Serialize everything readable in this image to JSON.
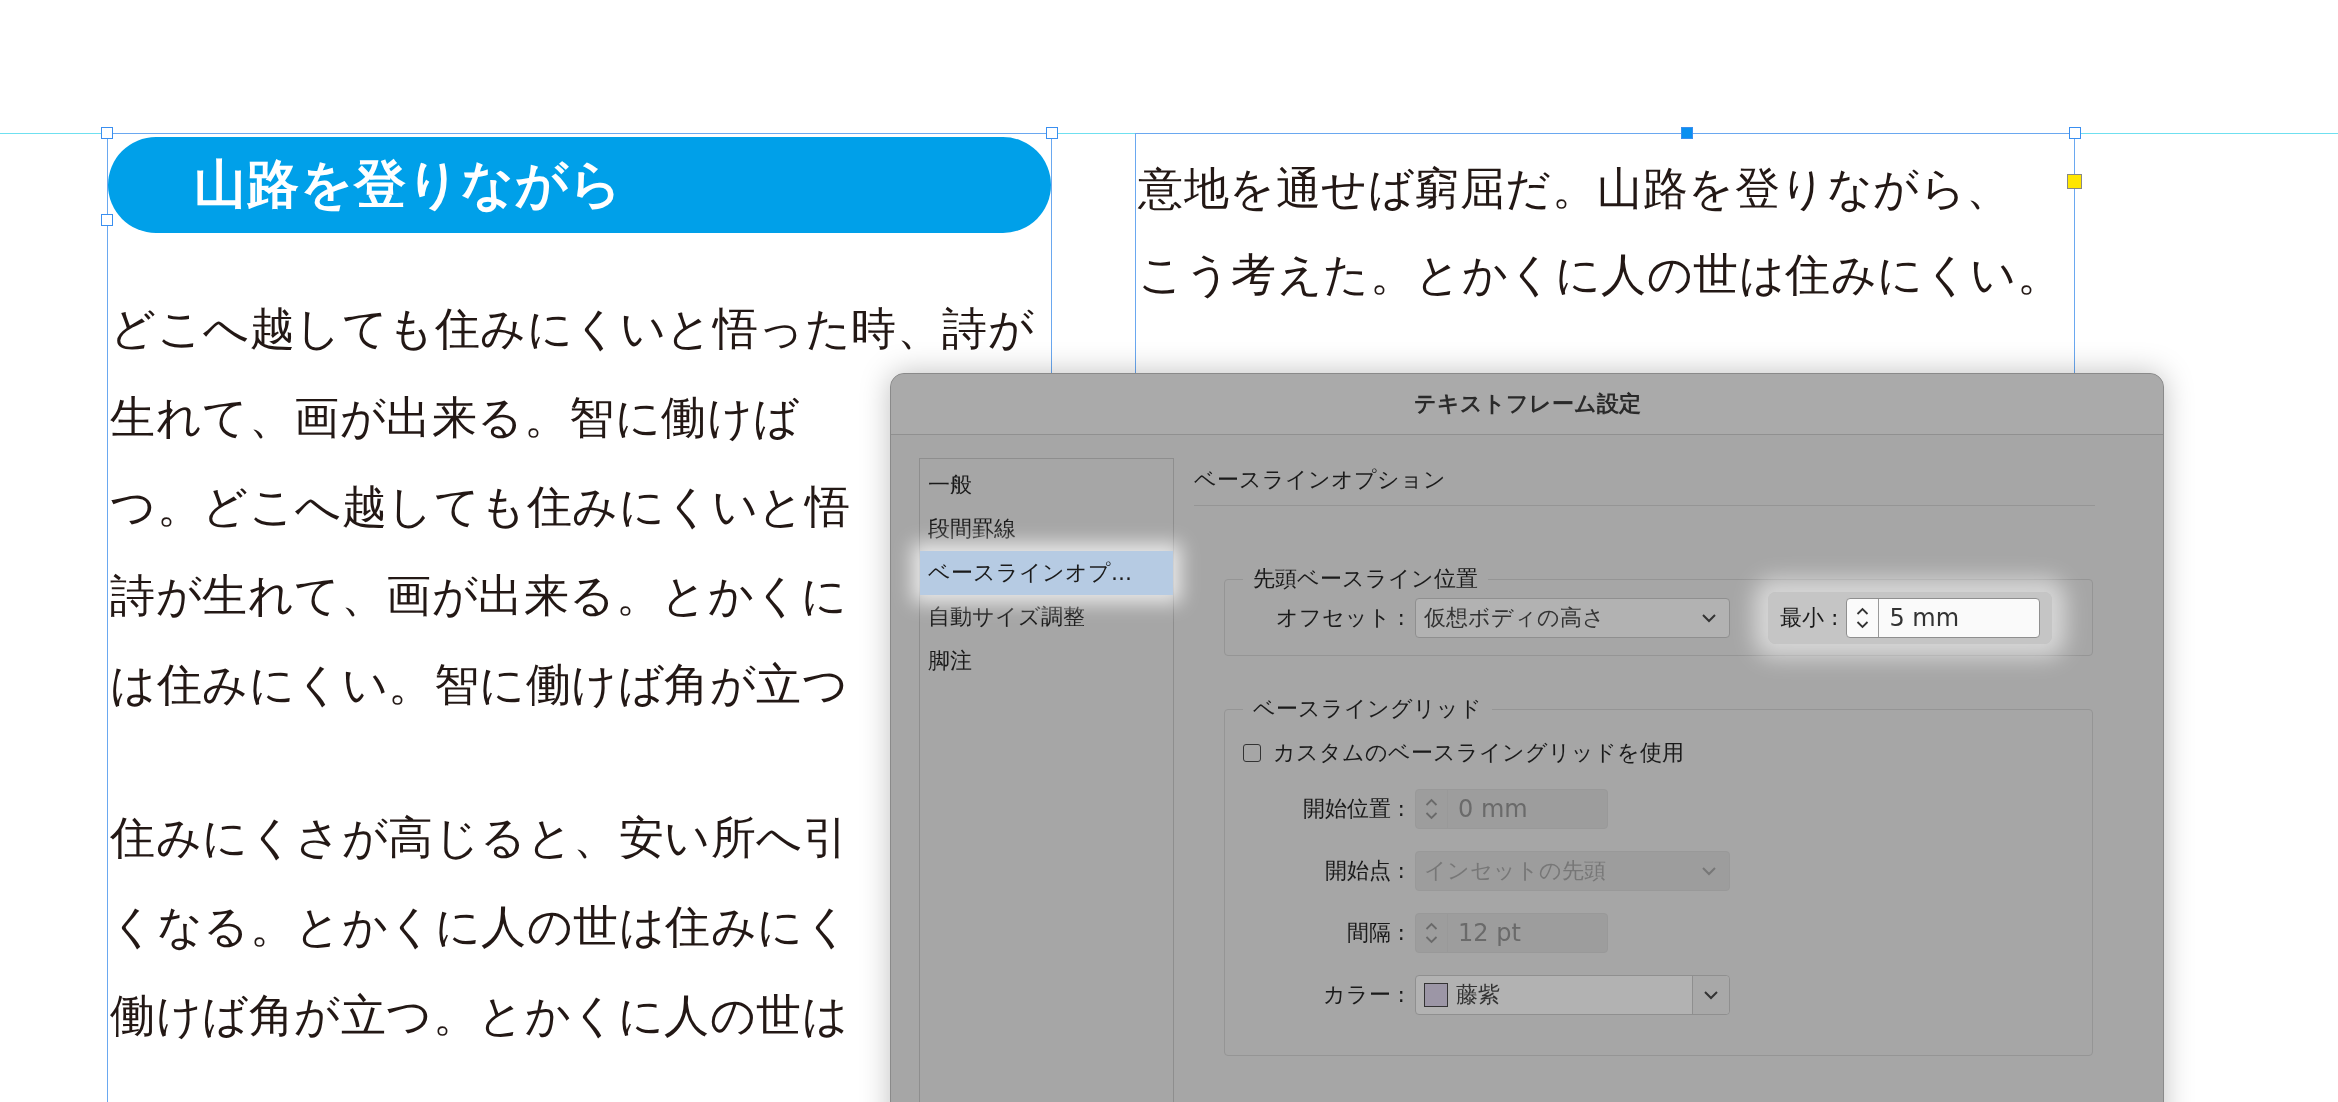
{
  "document": {
    "left_frame": {
      "heading": "山路を登りながら",
      "paragraphs": [
        [
          "どこへ越しても住みにくいと悟った時、詩が",
          "生れて、画が出来る。智に働けば",
          "つ。どこへ越しても住みにくいと悟",
          "詩が生れて、画が出来る。とかくに",
          "は住みにくい。智に働けば角が立つ"
        ],
        [
          "住みにくさが高じると、安い所へ引",
          "くなる。とかくに人の世は住みにく",
          "働けば角が立つ。とかくに人の世は"
        ]
      ]
    },
    "right_frame": {
      "lines": [
        "意地を通せば窮屈だ。山路を登りながら、",
        "こう考えた。とかくに人の世は住みにくい。"
      ]
    }
  },
  "dialog": {
    "title": "テキストフレーム設定",
    "sidebar": [
      {
        "label": "一般",
        "selected": false
      },
      {
        "label": "段間罫線",
        "selected": false
      },
      {
        "label": "ベースラインオプ...",
        "selected": true
      },
      {
        "label": "自動サイズ調整",
        "selected": false
      },
      {
        "label": "脚注",
        "selected": false
      }
    ],
    "section_title": "ベースラインオプション",
    "first_baseline": {
      "legend": "先頭ベースライン位置",
      "offset_label": "オフセット :",
      "offset_value": "仮想ボディの高さ",
      "min_label": "最小 :",
      "min_value": "5 mm"
    },
    "baseline_grid": {
      "legend": "ベースライングリッド",
      "custom": {
        "label": "カスタムのベースライングリッドを使用",
        "checked": false
      },
      "fields": [
        {
          "kind": "spinner",
          "label": "開始位置 :",
          "value": "0 mm",
          "disabled": true
        },
        {
          "kind": "dropdown",
          "label": "開始点 :",
          "value": "インセットの先頭",
          "disabled": true
        },
        {
          "kind": "spinner",
          "label": "間隔 :",
          "value": "12 pt",
          "disabled": true
        },
        {
          "kind": "color",
          "label": "カラー :",
          "value": "藤紫",
          "color": "#9c96a6",
          "disabled": false
        }
      ]
    }
  }
}
